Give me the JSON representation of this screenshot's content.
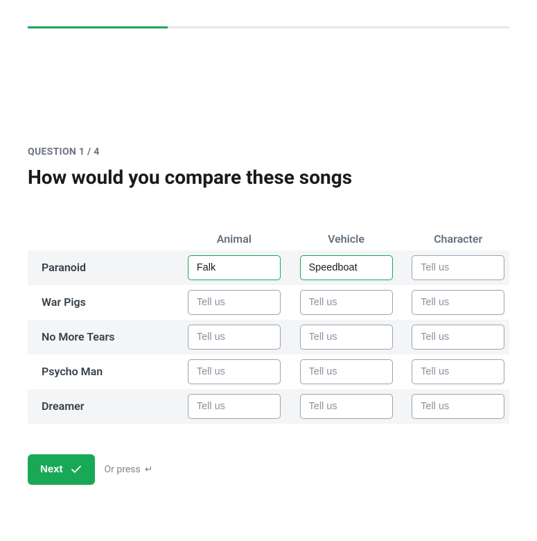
{
  "progress": {
    "current": 1,
    "total": 4
  },
  "question": {
    "number_label": "QUESTION 1 / 4",
    "title": "How would you compare these songs"
  },
  "columns": [
    "Animal",
    "Vehicle",
    "Character"
  ],
  "placeholder": "Tell us",
  "rows": [
    {
      "label": "Paranoid",
      "values": [
        "Falk",
        "Speedboat",
        ""
      ]
    },
    {
      "label": "War Pigs",
      "values": [
        "",
        "",
        ""
      ]
    },
    {
      "label": "No More Tears",
      "values": [
        "",
        "",
        ""
      ]
    },
    {
      "label": "Psycho Man",
      "values": [
        "",
        "",
        ""
      ]
    },
    {
      "label": "Dreamer",
      "values": [
        "",
        "",
        ""
      ]
    }
  ],
  "footer": {
    "next_label": "Next",
    "hint_prefix": "Or press",
    "hint_key": "↵"
  }
}
